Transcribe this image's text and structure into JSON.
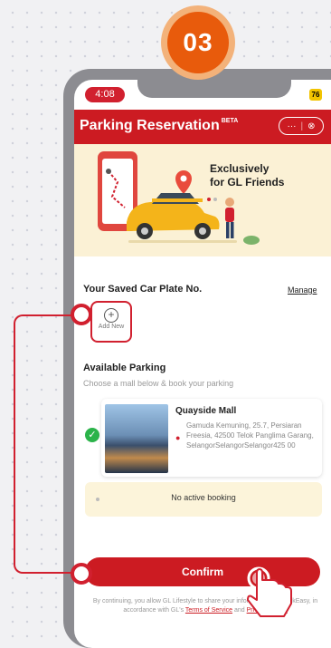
{
  "step": {
    "number": "03"
  },
  "status_bar": {
    "time": "4:08",
    "battery": "76"
  },
  "app_bar": {
    "title": "Parking Reservation",
    "badge": "BETA",
    "more_icon": "···",
    "close_icon": "⊗"
  },
  "banner": {
    "line1": "Exclusively",
    "line2": "for GL Friends",
    "dots": 2,
    "active_dot": 1
  },
  "car_plates": {
    "title": "Your Saved Car Plate No.",
    "manage_label": "Manage",
    "add_new_label": "Add New"
  },
  "parking": {
    "title": "Available Parking",
    "subtitle": "Choose a mall below & book your parking",
    "mall": {
      "name": "Quayside Mall",
      "address": "Gamuda Kemuning, 25.7, Persiaran Freesia, 42500 Telok Panglima Garang, SelangorSelangorSelangor425 00"
    }
  },
  "booking": {
    "status": "No active booking"
  },
  "confirm": {
    "label": "Confirm"
  },
  "disclaimer": {
    "text": "By continuing, you allow GL Lifestyle to share your information with ParkEasy, in accordance with GL's",
    "terms_label": "Terms of Service",
    "and": "and",
    "privacy_label": "Privacy Policy."
  },
  "colors": {
    "accent": "#cc1b22",
    "step_orange": "#e85b0c",
    "banner_bg": "#fbf1d5",
    "success": "#2bb34a"
  },
  "icons": [
    "plus-circle-icon",
    "check-icon",
    "location-pin-icon",
    "more-icon",
    "close-circle-icon",
    "hand-pointer-icon"
  ]
}
